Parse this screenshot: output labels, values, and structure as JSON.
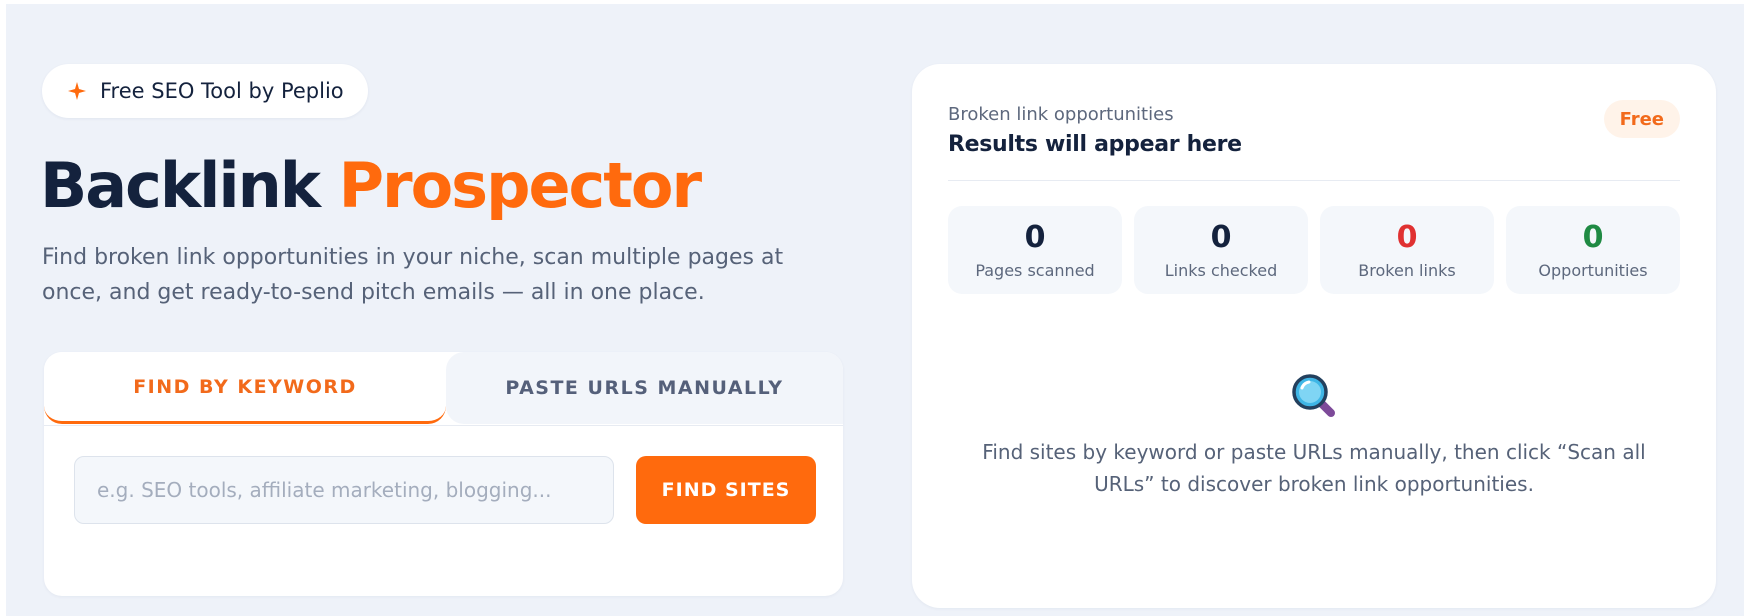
{
  "hero": {
    "badge_text": "Free SEO Tool by Peplio",
    "title_dark": "Backlink",
    "title_accent": "Prospector",
    "subtitle": "Find broken link opportunities in your niche, scan multiple pages at once, and get ready-to-send pitch emails — all in one place."
  },
  "form": {
    "tabs": [
      {
        "label": "FIND BY KEYWORD",
        "active": true
      },
      {
        "label": "PASTE URLS MANUALLY",
        "active": false
      }
    ],
    "keyword_input": {
      "placeholder": "e.g. SEO tools, affiliate marketing, blogging...",
      "value": ""
    },
    "find_button_label": "FIND SITES"
  },
  "results": {
    "label": "Broken link opportunities",
    "title": "Results will appear here",
    "badge": "Free",
    "stats": [
      {
        "value": "0",
        "label": "Pages scanned",
        "color": "#14223d"
      },
      {
        "value": "0",
        "label": "Links checked",
        "color": "#14223d"
      },
      {
        "value": "0",
        "label": "Broken links",
        "color": "#e03131"
      },
      {
        "value": "0",
        "label": "Opportunities",
        "color": "#1f8a43"
      }
    ],
    "empty_icon": "magnifier-icon",
    "empty_message": "Find sites by keyword or paste URLs manually, then click “Scan all URLs” to discover broken link opportunities."
  },
  "colors": {
    "accent": "#ff6a0d",
    "navy": "#14223d",
    "background": "#eef2f9"
  }
}
